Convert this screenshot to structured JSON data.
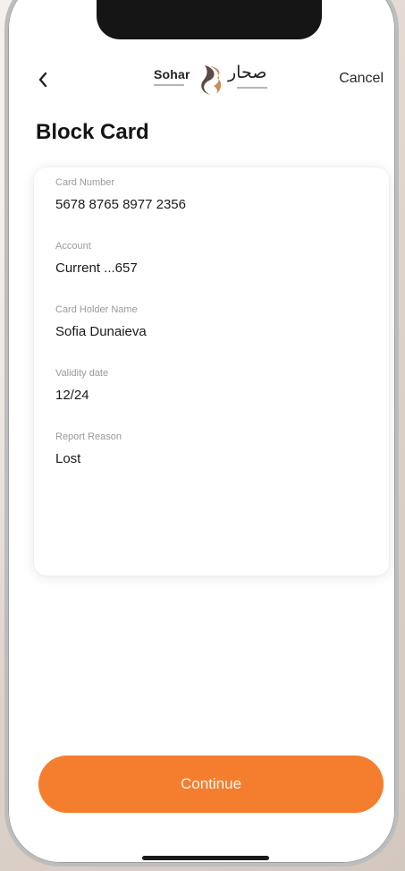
{
  "header": {
    "back_icon": "chevron-left-icon",
    "logo_latin": "Sohar",
    "logo_arabic": "صحار",
    "cancel_label": "Cancel"
  },
  "page": {
    "title": "Block Card"
  },
  "details": {
    "fields": [
      {
        "label": "Card Number",
        "value": "5678 8765 8977 2356"
      },
      {
        "label": "Account",
        "value": "Current ...657"
      },
      {
        "label": "Card Holder Name",
        "value": "Sofia Dunaieva"
      },
      {
        "label": "Validity date",
        "value": "12/24"
      },
      {
        "label": "Report Reason",
        "value": "Lost"
      }
    ]
  },
  "footer": {
    "continue_label": "Continue"
  },
  "colors": {
    "accent": "#f47e2e",
    "logo_mark_dark": "#5b4a45",
    "logo_mark_light": "#c98c5a"
  }
}
